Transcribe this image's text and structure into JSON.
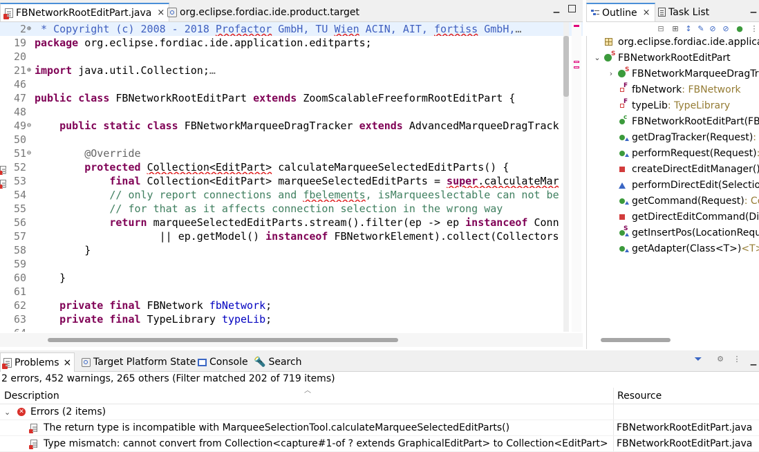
{
  "editor": {
    "tabs": [
      {
        "label": "FBNetworkRootEditPart.java",
        "close": "×"
      },
      {
        "label": "org.eclipse.fordiac.ide.product.target"
      }
    ],
    "lines": [
      {
        "num": "2",
        "fold": "⊕",
        "tokens": [
          {
            "t": " * Copyright (c) 2008 - 2018 ",
            "c": "jd"
          },
          {
            "t": "Profactor",
            "c": "jd sq"
          },
          {
            "t": " GmbH, TU ",
            "c": "jd"
          },
          {
            "t": "Wien",
            "c": "jd sq"
          },
          {
            "t": " ACIN, AIT, ",
            "c": "jd"
          },
          {
            "t": "fortiss",
            "c": "jd sq"
          },
          {
            "t": " GmbH,",
            "c": "jd"
          },
          {
            "t": "…",
            "c": "an"
          }
        ],
        "hl": true
      },
      {
        "num": "19",
        "tokens": [
          {
            "t": "package",
            "c": "kw"
          },
          {
            "t": " org.eclipse.fordiac.ide.application.editparts;"
          }
        ]
      },
      {
        "num": "20",
        "tokens": []
      },
      {
        "num": "21",
        "fold": "⊕",
        "tokens": [
          {
            "t": "import",
            "c": "kw"
          },
          {
            "t": " java.util.Collection;"
          },
          {
            "t": "…",
            "c": "an"
          }
        ]
      },
      {
        "num": "46",
        "tokens": []
      },
      {
        "num": "47",
        "tokens": [
          {
            "t": "public class",
            "c": "kw"
          },
          {
            "t": " FBNetworkRootEditPart "
          },
          {
            "t": "extends",
            "c": "kw"
          },
          {
            "t": " ZoomScalableFreeformRootEditPart {"
          }
        ]
      },
      {
        "num": "48",
        "tokens": []
      },
      {
        "num": "49",
        "fold": "⊖",
        "tokens": [
          {
            "t": "    "
          },
          {
            "t": "public static class",
            "c": "kw"
          },
          {
            "t": " FBNetworkMarqueeDragTracker "
          },
          {
            "t": "extends",
            "c": "kw"
          },
          {
            "t": " AdvancedMarqueeDragTracker {"
          }
        ]
      },
      {
        "num": "50",
        "tokens": []
      },
      {
        "num": "51",
        "fold": "⊖",
        "tokens": [
          {
            "t": "        "
          },
          {
            "t": "@Override",
            "c": "an"
          }
        ]
      },
      {
        "num": "52",
        "err": true,
        "tokens": [
          {
            "t": "        "
          },
          {
            "t": "protected",
            "c": "kw"
          },
          {
            "t": " "
          },
          {
            "t": "Collection<EditPart>",
            "c": "sq"
          },
          {
            "t": " calculateMarqueeSelectedEditParts() {"
          }
        ]
      },
      {
        "num": "53",
        "err": true,
        "tokens": [
          {
            "t": "            "
          },
          {
            "t": "final",
            "c": "kw"
          },
          {
            "t": " Collection<EditPart> marqueeSelectedEditParts = "
          },
          {
            "t": "super",
            "c": "kw sq"
          },
          {
            "t": ".calculateMarqueeSelectedEditParts();",
            "c": "sq"
          }
        ]
      },
      {
        "num": "54",
        "tokens": [
          {
            "t": "            "
          },
          {
            "t": "// only report connections and ",
            "c": "cm"
          },
          {
            "t": "fbelements",
            "c": "cm sq"
          },
          {
            "t": ", isMarqueeslectable can not be",
            "c": "cm"
          }
        ]
      },
      {
        "num": "55",
        "tokens": [
          {
            "t": "            "
          },
          {
            "t": "// for that as it affects connection selection in the wrong way",
            "c": "cm"
          }
        ]
      },
      {
        "num": "56",
        "tokens": [
          {
            "t": "            "
          },
          {
            "t": "return",
            "c": "kw"
          },
          {
            "t": " marqueeSelectedEditParts.stream().filter(ep -> ep "
          },
          {
            "t": "instanceof",
            "c": "kw"
          },
          {
            "t": " ConnectionEditPart"
          }
        ]
      },
      {
        "num": "57",
        "tokens": [
          {
            "t": "                    || ep.getModel() "
          },
          {
            "t": "instanceof",
            "c": "kw"
          },
          {
            "t": " FBNetworkElement).collect(Collectors.toList());"
          }
        ]
      },
      {
        "num": "58",
        "tokens": [
          {
            "t": "        }"
          }
        ]
      },
      {
        "num": "59",
        "tokens": []
      },
      {
        "num": "60",
        "tokens": [
          {
            "t": "    }"
          }
        ]
      },
      {
        "num": "61",
        "tokens": []
      },
      {
        "num": "62",
        "tokens": [
          {
            "t": "    "
          },
          {
            "t": "private final",
            "c": "kw"
          },
          {
            "t": " FBNetwork "
          },
          {
            "t": "fbNetwork",
            "c": "fld"
          },
          {
            "t": ";"
          }
        ]
      },
      {
        "num": "63",
        "tokens": [
          {
            "t": "    "
          },
          {
            "t": "private final",
            "c": "kw"
          },
          {
            "t": " TypeLibrary "
          },
          {
            "t": "typeLib",
            "c": "fld"
          },
          {
            "t": ";"
          }
        ]
      },
      {
        "num": "64",
        "tokens": []
      }
    ]
  },
  "outline": {
    "tabs": [
      {
        "label": "Outline",
        "close": "×"
      },
      {
        "label": "Task List"
      }
    ],
    "items": [
      {
        "label": "org.eclipse.fordiac.ide.application.editparts",
        "type": "",
        "indent": 0,
        "icon": "package-icon",
        "twisty": ""
      },
      {
        "label": "FBNetworkRootEditPart",
        "type": "",
        "indent": 0,
        "icon": "class-icon",
        "twisty": "⌄"
      },
      {
        "label": "FBNetworkMarqueeDragTracker",
        "type": "",
        "indent": 1,
        "icon": "nested-class-icon",
        "twisty": "›"
      },
      {
        "label": "fbNetwork",
        "type": " : FBNetwork",
        "indent": 1,
        "icon": "field-icon",
        "twisty": ""
      },
      {
        "label": "typeLib",
        "type": " : TypeLibrary",
        "indent": 1,
        "icon": "field-icon",
        "twisty": ""
      },
      {
        "label": "FBNetworkRootEditPart(FBNetwork, TypeLibrary)",
        "type": "",
        "indent": 1,
        "icon": "constructor-icon",
        "twisty": ""
      },
      {
        "label": "getDragTracker(Request)",
        "type": " : DragTracker",
        "indent": 1,
        "icon": "override-method-icon",
        "twisty": ""
      },
      {
        "label": "performRequest(Request)",
        "type": " : void",
        "indent": 1,
        "icon": "override-method-icon",
        "twisty": ""
      },
      {
        "label": "createDirectEditManager()",
        "type": "",
        "indent": 1,
        "icon": "private-method-icon",
        "twisty": ""
      },
      {
        "label": "performDirectEdit(Selection)",
        "type": "",
        "indent": 1,
        "icon": "protected-method-icon",
        "twisty": ""
      },
      {
        "label": "getCommand(Request)",
        "type": " : Command",
        "indent": 1,
        "icon": "override-method-icon",
        "twisty": ""
      },
      {
        "label": "getDirectEditCommand(DirectEditRequest)",
        "type": "",
        "indent": 1,
        "icon": "private-method-icon",
        "twisty": ""
      },
      {
        "label": "getInsertPos(LocationRequest)",
        "type": "",
        "indent": 1,
        "icon": "static-method-icon",
        "twisty": ""
      },
      {
        "label": "getAdapter(Class<T>)",
        "type": " <T>",
        "indent": 1,
        "icon": "override-method-icon",
        "twisty": ""
      }
    ]
  },
  "problems": {
    "tabs": [
      {
        "label": "Problems",
        "close": "×"
      },
      {
        "label": "Target Platform State"
      },
      {
        "label": "Console"
      },
      {
        "label": "Search"
      }
    ],
    "summary": "2 errors, 452 warnings, 265 others (Filter matched 202 of 719 items)",
    "columns": {
      "description": "Description",
      "resource": "Resource"
    },
    "group": {
      "label": "Errors (2 items)",
      "twisty": "⌄"
    },
    "rows": [
      {
        "description": "The return type is incompatible with MarqueeSelectionTool.calculateMarqueeSelectedEditParts()",
        "resource": "FBNetworkRootEditPart.java"
      },
      {
        "description": "Type mismatch: cannot convert from Collection<capture#1-of ? extends GraphicalEditPart> to Collection<EditPart>",
        "resource": "FBNetworkRootEditPart.java"
      }
    ]
  },
  "colors": {
    "accent": "#4a8fd8",
    "error": "#d9302a",
    "keyword": "#7f0055",
    "comment": "#3f7f5f"
  }
}
